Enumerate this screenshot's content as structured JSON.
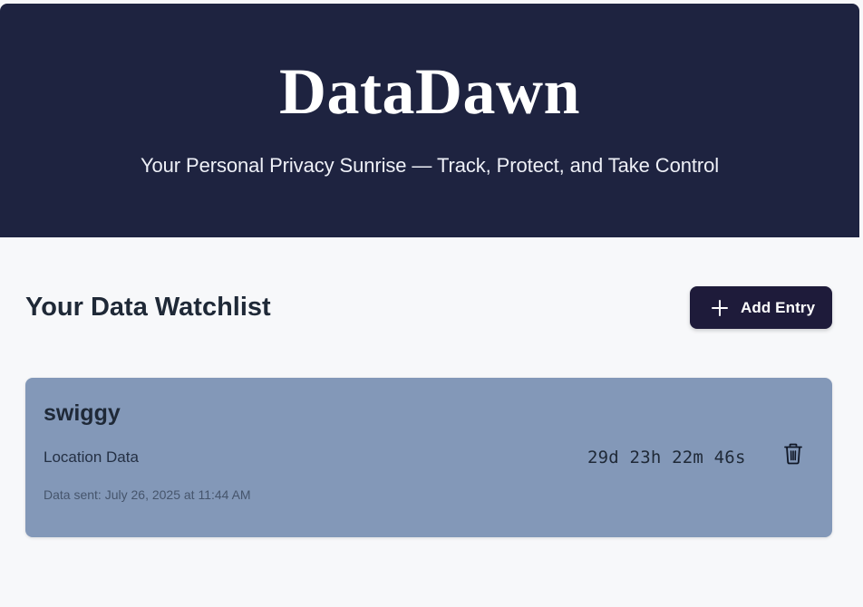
{
  "header": {
    "title": "DataDawn",
    "subtitle": "Your Personal Privacy Sunrise — Track, Protect, and Take Control"
  },
  "watchlist": {
    "title": "Your Data Watchlist",
    "add_button": {
      "label": "Add Entry",
      "icon": "plus-icon"
    },
    "entries": [
      {
        "name": "swiggy",
        "category": "Location Data",
        "sent_prefix": "Data sent:",
        "sent_date": "July 26, 2025 at 11:44 AM",
        "countdown": "29d 23h 22m 46s",
        "delete_icon": "trash-icon"
      }
    ]
  },
  "colors": {
    "header_bg": "#1e2340",
    "page_bg": "#f7f8fa",
    "button_bg": "#1e1b3a",
    "card_bg": "#8398b8",
    "text_dark": "#1f2937"
  }
}
